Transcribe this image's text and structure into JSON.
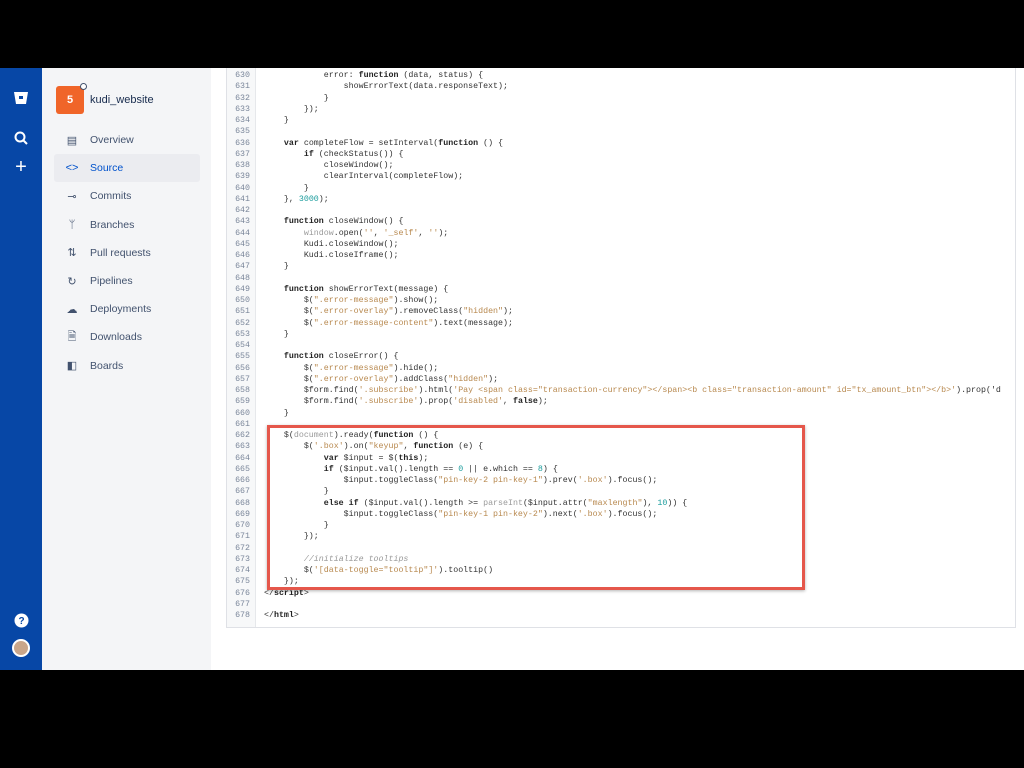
{
  "repo": {
    "name": "kudi_website",
    "logo_text": "5"
  },
  "global_nav": {
    "icons": [
      "bitbucket-logo-icon",
      "search-icon",
      "plus-icon",
      "help-icon",
      "avatar"
    ]
  },
  "sidebar": {
    "items": [
      {
        "label": "Overview",
        "icon": "▤",
        "active": false
      },
      {
        "label": "Source",
        "icon": "<>",
        "active": true
      },
      {
        "label": "Commits",
        "icon": "⊸",
        "active": false
      },
      {
        "label": "Branches",
        "icon": "ᛘ",
        "active": false
      },
      {
        "label": "Pull requests",
        "icon": "⇅",
        "active": false
      },
      {
        "label": "Pipelines",
        "icon": "↻",
        "active": false
      },
      {
        "label": "Deployments",
        "icon": "☁",
        "active": false
      },
      {
        "label": "Downloads",
        "icon": "🗎",
        "active": false
      },
      {
        "label": "Boards",
        "icon": "◧",
        "active": false
      }
    ]
  },
  "code": {
    "first_line": 630,
    "lines": [
      [
        [
          "",
          "            error: "
        ],
        [
          "k",
          "function"
        ],
        [
          "",
          " (data, status) {"
        ]
      ],
      [
        [
          "",
          "                showErrorText(data.responseText);"
        ]
      ],
      [
        [
          "",
          "            }"
        ]
      ],
      [
        [
          "",
          "        });"
        ]
      ],
      [
        [
          "",
          "    }"
        ]
      ],
      [],
      [
        [
          "",
          "    "
        ],
        [
          "k",
          "var"
        ],
        [
          "",
          " completeFlow = setInterval("
        ],
        [
          "k",
          "function"
        ],
        [
          "",
          " () {"
        ]
      ],
      [
        [
          "",
          "        "
        ],
        [
          "k",
          "if"
        ],
        [
          "",
          " (checkStatus()) {"
        ]
      ],
      [
        [
          "",
          "            closeWindow();"
        ]
      ],
      [
        [
          "",
          "            clearInterval(completeFlow);"
        ]
      ],
      [
        [
          "",
          "        }"
        ]
      ],
      [
        [
          "",
          "    }, "
        ],
        [
          "n",
          "3000"
        ],
        [
          "",
          ");"
        ]
      ],
      [],
      [
        [
          "",
          "    "
        ],
        [
          "k",
          "function"
        ],
        [
          "",
          " closeWindow() {"
        ]
      ],
      [
        [
          "",
          "        "
        ],
        [
          "b",
          "window"
        ],
        [
          "",
          ".open("
        ],
        [
          "s",
          "''"
        ],
        [
          "",
          ", "
        ],
        [
          "s",
          "'_self'"
        ],
        [
          "",
          ", "
        ],
        [
          "s",
          "''"
        ],
        [
          "",
          ");"
        ]
      ],
      [
        [
          "",
          "        Kudi.closeWindow();"
        ]
      ],
      [
        [
          "",
          "        Kudi.closeIframe();"
        ]
      ],
      [
        [
          "",
          "    }"
        ]
      ],
      [],
      [
        [
          "",
          "    "
        ],
        [
          "k",
          "function"
        ],
        [
          "",
          " showErrorText(message) {"
        ]
      ],
      [
        [
          "",
          "        $("
        ],
        [
          "s",
          "\".error-message\""
        ],
        [
          "",
          ").show();"
        ]
      ],
      [
        [
          "",
          "        $("
        ],
        [
          "s",
          "\".error-overlay\""
        ],
        [
          "",
          ").removeClass("
        ],
        [
          "s",
          "\"hidden\""
        ],
        [
          "",
          ");"
        ]
      ],
      [
        [
          "",
          "        $("
        ],
        [
          "s",
          "\".error-message-content\""
        ],
        [
          "",
          ").text(message);"
        ]
      ],
      [
        [
          "",
          "    }"
        ]
      ],
      [],
      [
        [
          "",
          "    "
        ],
        [
          "k",
          "function"
        ],
        [
          "",
          " closeError() {"
        ]
      ],
      [
        [
          "",
          "        $("
        ],
        [
          "s",
          "\".error-message\""
        ],
        [
          "",
          ").hide();"
        ]
      ],
      [
        [
          "",
          "        $("
        ],
        [
          "s",
          "\".error-overlay\""
        ],
        [
          "",
          ").addClass("
        ],
        [
          "s",
          "\"hidden\""
        ],
        [
          "",
          ");"
        ]
      ],
      [
        [
          "",
          "        $form.find("
        ],
        [
          "s",
          "'.subscribe'"
        ],
        [
          "",
          ").html("
        ],
        [
          "s",
          "'Pay <span class=\"transaction-currency\"></span><b class=\"transaction-amount\" id=\"tx_amount_btn\"></b>'"
        ],
        [
          "",
          ").prop('d"
        ]
      ],
      [
        [
          "",
          "        $form.find("
        ],
        [
          "s",
          "'.subscribe'"
        ],
        [
          "",
          ").prop("
        ],
        [
          "s",
          "'disabled'"
        ],
        [
          "",
          ", "
        ],
        [
          "k",
          "false"
        ],
        [
          "",
          ");"
        ]
      ],
      [
        [
          "",
          "    }"
        ]
      ],
      [],
      [
        [
          "",
          "    $("
        ],
        [
          "b",
          "document"
        ],
        [
          "",
          ").ready("
        ],
        [
          "k",
          "function"
        ],
        [
          "",
          " () {"
        ]
      ],
      [
        [
          "",
          "        $("
        ],
        [
          "s",
          "'.box'"
        ],
        [
          "",
          ").on("
        ],
        [
          "s",
          "\"keyup\""
        ],
        [
          "",
          ", "
        ],
        [
          "k",
          "function"
        ],
        [
          "",
          " (e) {"
        ]
      ],
      [
        [
          "",
          "            "
        ],
        [
          "k",
          "var"
        ],
        [
          "",
          " $input = $("
        ],
        [
          "k",
          "this"
        ],
        [
          "",
          ");"
        ]
      ],
      [
        [
          "",
          "            "
        ],
        [
          "k",
          "if"
        ],
        [
          "",
          " ($input.val().length == "
        ],
        [
          "n",
          "0"
        ],
        [
          "",
          " || e.which == "
        ],
        [
          "n",
          "8"
        ],
        [
          "",
          ") {"
        ]
      ],
      [
        [
          "",
          "                $input.toggleClass("
        ],
        [
          "s",
          "\"pin-key-2 pin-key-1\""
        ],
        [
          "",
          ").prev("
        ],
        [
          "s",
          "'.box'"
        ],
        [
          "",
          ").focus();"
        ]
      ],
      [
        [
          "",
          "            }"
        ]
      ],
      [
        [
          "",
          "            "
        ],
        [
          "k",
          "else if"
        ],
        [
          "",
          " ($input.val().length >= "
        ],
        [
          "b",
          "parseInt"
        ],
        [
          "",
          "($input.attr("
        ],
        [
          "s",
          "\"maxlength\""
        ],
        [
          "",
          "), "
        ],
        [
          "n",
          "10"
        ],
        [
          "",
          ")) {"
        ]
      ],
      [
        [
          "",
          "                $input.toggleClass("
        ],
        [
          "s",
          "\"pin-key-1 pin-key-2\""
        ],
        [
          "",
          ").next("
        ],
        [
          "s",
          "'.box'"
        ],
        [
          "",
          ").focus();"
        ]
      ],
      [
        [
          "",
          "            }"
        ]
      ],
      [
        [
          "",
          "        });"
        ]
      ],
      [],
      [
        [
          "",
          "        "
        ],
        [
          "c",
          "//initialize tooltips"
        ]
      ],
      [
        [
          "",
          "        $("
        ],
        [
          "s",
          "'[data-toggle=\"tooltip\"]'"
        ],
        [
          "",
          ").tooltip()"
        ]
      ],
      [
        [
          "",
          "    });"
        ]
      ],
      [
        [
          "",
          "</"
        ],
        [
          "k",
          "script"
        ],
        [
          "",
          ">"
        ]
      ],
      [],
      [
        [
          "",
          "</"
        ],
        [
          "k",
          "html"
        ],
        [
          "",
          ">"
        ]
      ]
    ]
  }
}
